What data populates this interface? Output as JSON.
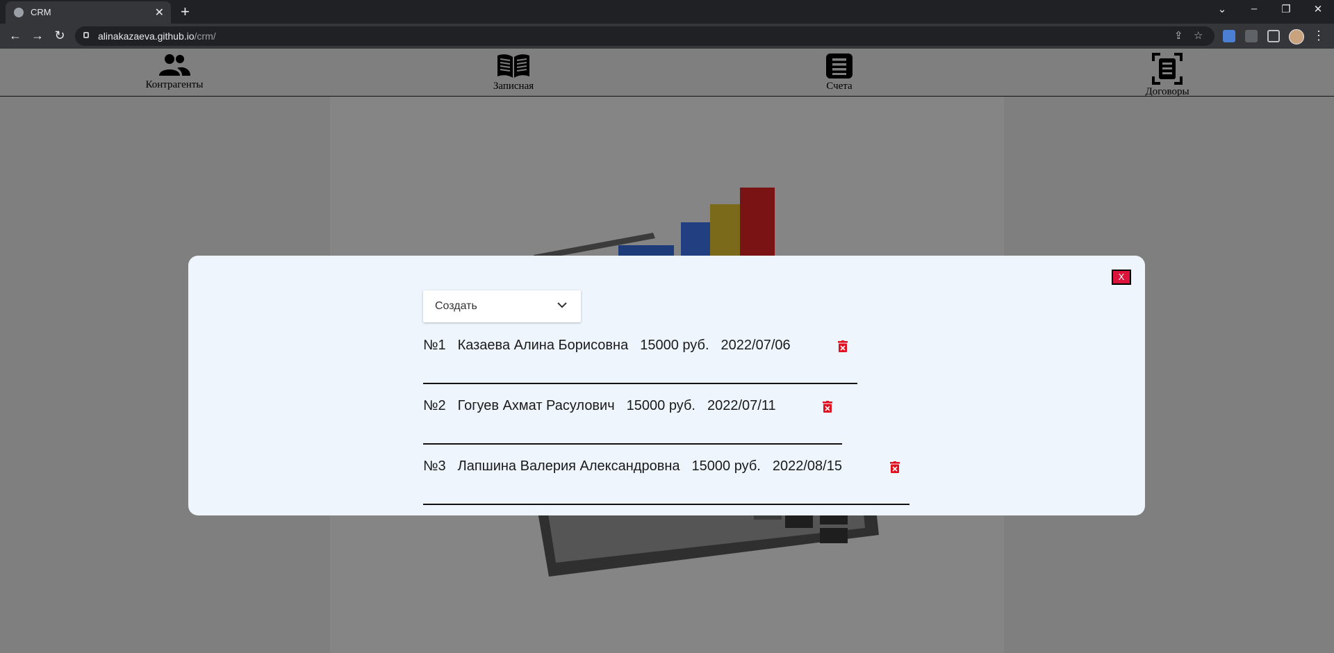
{
  "browser": {
    "tab_title": "CRM",
    "url_host": "alinakazaeva.github.io",
    "url_path": "/crm/"
  },
  "nav": [
    {
      "label": "Контрагенты",
      "icon": "users-icon"
    },
    {
      "label": "Записная",
      "icon": "book-open-icon"
    },
    {
      "label": "Счета",
      "icon": "document-list-icon"
    },
    {
      "label": "Договоры",
      "icon": "document-scan-icon"
    }
  ],
  "modal": {
    "close_label": "X",
    "select_value": "Создать",
    "contracts": [
      {
        "num": "№1",
        "name": "Казаева Алина Борисовна",
        "amount": "15000 руб.",
        "date": "2022/07/06"
      },
      {
        "num": "№2",
        "name": "Гогуев Ахмат Расулович",
        "amount": "15000 руб.",
        "date": "2022/07/11"
      },
      {
        "num": "№3",
        "name": "Лапшина Валерия Александровна",
        "amount": "15000 руб.",
        "date": "2022/08/15"
      }
    ]
  },
  "colors": {
    "overlay": "#7f7f7f",
    "modal_bg": "#eef5fd",
    "close_button": "#dc143c",
    "delete_icon": "#e0101e"
  }
}
